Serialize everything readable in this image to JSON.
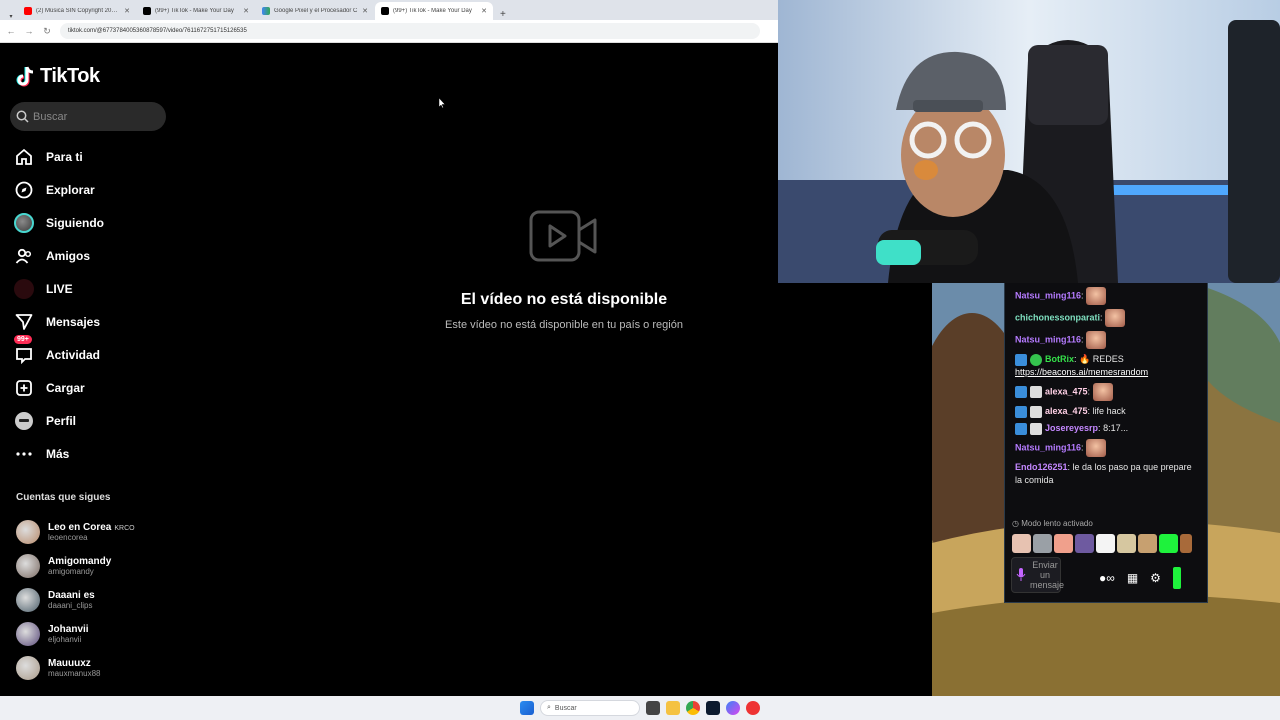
{
  "browser": {
    "tabs": [
      {
        "title": "(2) Música SIN Copyright 2026 ·",
        "type": "yt"
      },
      {
        "title": "(99+) TikTok - Make Your Day",
        "type": "tt"
      },
      {
        "title": "Google Pixel y el Procesador C",
        "type": "g"
      },
      {
        "title": "(99+) TikTok - Make Your Day",
        "type": "tt",
        "active": true
      }
    ],
    "url": "tiktok.com/@6773784005360878597/video/7611672751715126535"
  },
  "tiktok": {
    "logo": "TikTok",
    "search_placeholder": "Buscar",
    "nav": [
      {
        "label": "Para ti",
        "icon": "home-icon"
      },
      {
        "label": "Explorar",
        "icon": "compass-icon"
      },
      {
        "label": "Siguiendo",
        "icon": "following-avatar-icon"
      },
      {
        "label": "Amigos",
        "icon": "friends-icon"
      },
      {
        "label": "LIVE",
        "icon": "live-icon"
      },
      {
        "label": "Mensajes",
        "icon": "send-icon"
      },
      {
        "label": "Actividad",
        "icon": "inbox-icon",
        "badge": "99+"
      },
      {
        "label": "Cargar",
        "icon": "upload-icon"
      },
      {
        "label": "Perfil",
        "icon": "profile-icon"
      },
      {
        "label": "Más",
        "icon": "more-icon"
      }
    ],
    "following_title": "Cuentas que sigues",
    "following": [
      {
        "name": "Leo en Corea",
        "extra": "KRCO",
        "user": "leoencorea",
        "color": "#b88a6a"
      },
      {
        "name": "Amigomandy",
        "extra": "",
        "user": "amigomandy",
        "color": "#7a6a62"
      },
      {
        "name": "Daaani es",
        "extra": "",
        "user": "daaani_clips",
        "color": "#4b5e6a"
      },
      {
        "name": "Johanvii",
        "extra": "",
        "user": "eljohanvii",
        "color": "#5a4a7a"
      },
      {
        "name": "Mauuuxz",
        "extra": "",
        "user": "mauxmanux88",
        "color": "#a99a88"
      }
    ],
    "unavailable_title": "El vídeo no está disponible",
    "unavailable_sub": "Este vídeo no está disponible en tu país o región"
  },
  "chat": {
    "messages": [
      {
        "user": "Natsu_ming116",
        "color": "#b57bff",
        "text": "",
        "emote": true
      },
      {
        "user": "chichonessonparati",
        "color": "#7fe0c0",
        "text": "",
        "emote": true
      },
      {
        "user": "Natsu_ming116",
        "color": "#b57bff",
        "text": "",
        "emote": true
      },
      {
        "user": "BotRix",
        "color": "#35e04a",
        "text": "🔥 REDES",
        "link": "https://beacons.ai/memesrandom",
        "badges": [
          "blue",
          "green"
        ]
      },
      {
        "user": "alexa_475",
        "color": "#ffd0e6",
        "text": "",
        "emote": true,
        "badges": [
          "blue",
          "grey"
        ]
      },
      {
        "user": "alexa_475",
        "color": "#ffd0e6",
        "text": "life hack",
        "badges": [
          "blue",
          "grey"
        ]
      },
      {
        "user": "Josereyesrp",
        "color": "#c488ff",
        "text": "8:17...",
        "badges": [
          "blue",
          "grey"
        ]
      },
      {
        "user": "Natsu_ming116",
        "color": "#b57bff",
        "text": "",
        "emote": true
      },
      {
        "user": "Endo126251",
        "color": "#c488ff",
        "text": "le da los paso pa que prepare la comida"
      }
    ],
    "slow_mode": "Modo lento activado",
    "input_placeholder": "Enviar un mensaje",
    "colors": {
      "accent": "#1ef23c",
      "bg": "#0d0d10"
    }
  },
  "taskbar": {
    "search_placeholder": "Buscar"
  }
}
